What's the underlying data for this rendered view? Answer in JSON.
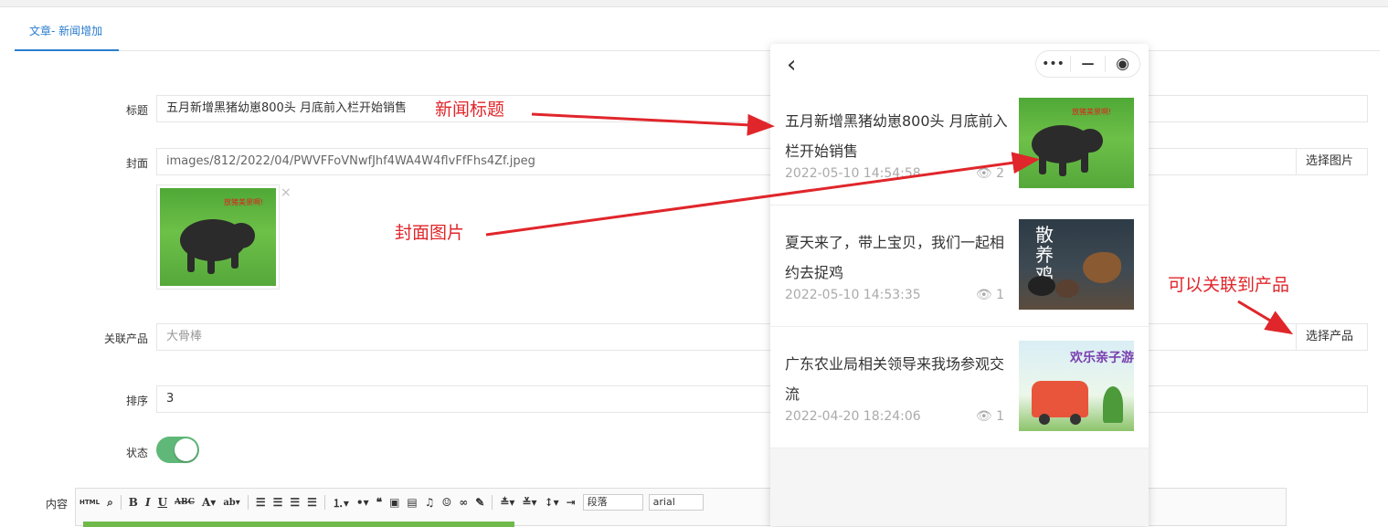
{
  "tab": {
    "label": "文章- 新闻增加"
  },
  "form": {
    "title_label": "标题",
    "title_value": "五月新增黑猪幼崽800头 月底前入栏开始销售",
    "cover_label": "封面",
    "cover_value": "images/812/2022/04/PWVFFoVNwfJhf4WA4W4flvFfFhs4Zf.jpeg",
    "cover_button": "选择图片",
    "cover_close": "×",
    "cover_caption": "放猪美景啊!",
    "product_label": "关联产品",
    "product_placeholder": "大骨棒",
    "product_button": "选择产品",
    "sort_label": "排序",
    "sort_value": "3",
    "status_label": "状态",
    "status_on": true,
    "content_label": "内容"
  },
  "editor": {
    "toolbar_html": "HTML",
    "paragraph_select": "段落",
    "font_select": "arial"
  },
  "annotations": {
    "title_note": "新闻标题",
    "cover_note": "封面图片",
    "product_note": "可以关联到产品"
  },
  "phone": {
    "back_icon": "‹",
    "capsule_more": "•••",
    "capsule_min": "—",
    "capsule_close": "◉",
    "news": [
      {
        "title": "五月新增黑猪幼崽800头 月底前入栏开始销售",
        "date": "2022-05-10 14:54:58",
        "views": "2",
        "image": "pig"
      },
      {
        "title": "夏天来了，带上宝贝，我们一起相约去捉鸡",
        "date": "2022-05-10 14:53:35",
        "views": "1",
        "image": "chicken"
      },
      {
        "title": "广东农业局相关领导来我场参观交流",
        "date": "2022-04-20 18:24:06",
        "views": "1",
        "image": "travel"
      }
    ],
    "chicken_caption": "散养鸡",
    "travel_caption": "欢乐亲子游"
  },
  "colors": {
    "accent": "#2a7dd0",
    "toggle": "#5fb878",
    "annotation": "#e0262b"
  }
}
